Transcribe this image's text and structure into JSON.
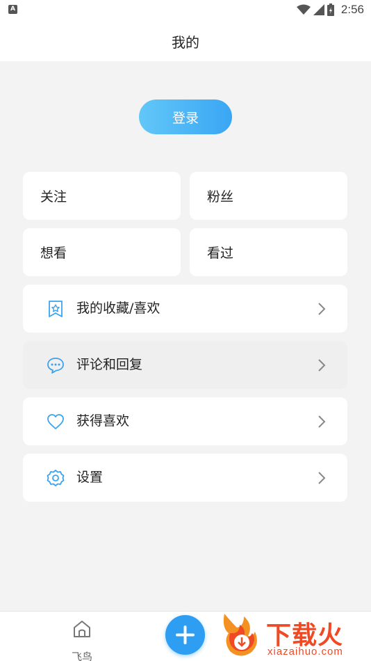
{
  "status_bar": {
    "notification_badge": "A",
    "time": "2:56",
    "icons": [
      "wifi-icon",
      "signal-icon",
      "battery-icon"
    ]
  },
  "header": {
    "title": "我的"
  },
  "login": {
    "label": "登录"
  },
  "stats": [
    {
      "label": "关注"
    },
    {
      "label": "粉丝"
    },
    {
      "label": "想看"
    },
    {
      "label": "看过"
    }
  ],
  "menu": [
    {
      "icon": "bookmark-star-icon",
      "label": "我的收藏/喜欢"
    },
    {
      "icon": "comment-bubble-icon",
      "label": "评论和回复"
    },
    {
      "icon": "heart-icon",
      "label": "获得喜欢"
    },
    {
      "icon": "settings-gear-icon",
      "label": "设置"
    }
  ],
  "tabbar": {
    "home_label": "飞鸟",
    "add_icon": "plus-icon"
  },
  "watermark": {
    "text": "下载火",
    "domain": "xiazaihuo.com"
  },
  "colors": {
    "accent": "#2d9ef2",
    "login_gradient_start": "#62c7f8",
    "login_gradient_end": "#3aa6f4",
    "page_background": "#f3f3f4",
    "watermark": "#ef4a24"
  }
}
